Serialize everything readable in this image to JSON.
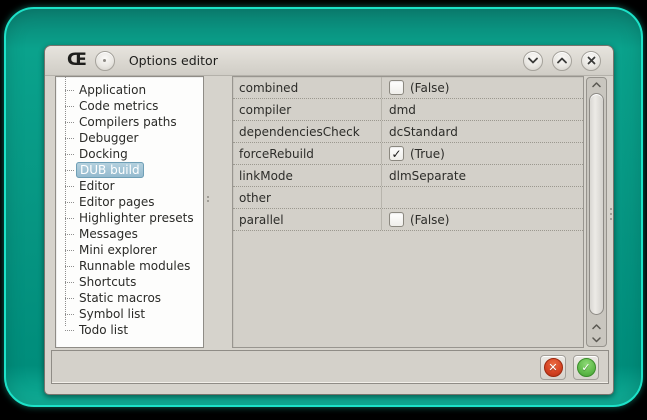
{
  "window": {
    "title": "Options editor",
    "logo_glyph": "Œ",
    "controls": {
      "minimize": "chevron-down",
      "maximize": "chevron-up",
      "close": "x"
    }
  },
  "sidebar": {
    "items": [
      {
        "label": "Application",
        "selected": false
      },
      {
        "label": "Code metrics",
        "selected": false
      },
      {
        "label": "Compilers paths",
        "selected": false
      },
      {
        "label": "Debugger",
        "selected": false
      },
      {
        "label": "Docking",
        "selected": false
      },
      {
        "label": "DUB build",
        "selected": true
      },
      {
        "label": "Editor",
        "selected": false
      },
      {
        "label": "Editor pages",
        "selected": false
      },
      {
        "label": "Highlighter presets",
        "selected": false
      },
      {
        "label": "Messages",
        "selected": false
      },
      {
        "label": "Mini explorer",
        "selected": false
      },
      {
        "label": "Runnable modules",
        "selected": false
      },
      {
        "label": "Shortcuts",
        "selected": false
      },
      {
        "label": "Static macros",
        "selected": false
      },
      {
        "label": "Symbol list",
        "selected": false
      },
      {
        "label": "Todo list",
        "selected": false
      }
    ]
  },
  "grid": {
    "rows": [
      {
        "name": "combined",
        "type": "bool",
        "value": "(False)",
        "check_glyph": ""
      },
      {
        "name": "compiler",
        "type": "text",
        "value": "dmd",
        "check_glyph": ""
      },
      {
        "name": "dependenciesCheck",
        "type": "text",
        "value": "dcStandard",
        "check_glyph": ""
      },
      {
        "name": "forceRebuild",
        "type": "bool",
        "value": "(True)",
        "check_glyph": "✓"
      },
      {
        "name": "linkMode",
        "type": "text",
        "value": "dlmSeparate",
        "check_glyph": ""
      },
      {
        "name": "other",
        "type": "text",
        "value": "",
        "check_glyph": ""
      },
      {
        "name": "parallel",
        "type": "bool",
        "value": "(False)",
        "check_glyph": ""
      }
    ]
  },
  "footer": {
    "cancel_glyph": "✕",
    "accept_glyph": "✓"
  },
  "colors": {
    "frame_teal": "#069582",
    "frame_cyan_edge": "#1ce2c8",
    "window_bg": "#d6d3cc",
    "selection_bg": "#9dbfd2",
    "cancel_red": "#d64424",
    "accept_green": "#63bd4d"
  }
}
